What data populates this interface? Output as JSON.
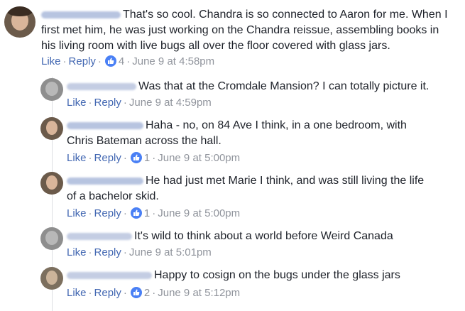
{
  "comments": [
    {
      "text": "That's so cool. Chandra is so connected to Aaron for me. When I first met him, he was just working on the Chandra reissue, assembling books in his living room with live bugs all over the floor covered with glass jars.",
      "like": "Like",
      "reply": "Reply",
      "reactions": "4",
      "time": "June 9 at 4:58pm"
    },
    {
      "text": "Was that at the Cromdale Mansion? I can totally picture it.",
      "like": "Like",
      "reply": "Reply",
      "reactions": "",
      "time": "June 9 at 4:59pm"
    },
    {
      "text": "Haha - no, on 84 Ave I think, in a one bedroom, with Chris Bateman across the hall.",
      "like": "Like",
      "reply": "Reply",
      "reactions": "1",
      "time": "June 9 at 5:00pm"
    },
    {
      "text": "He had just met Marie I think, and was still living the life of a bachelor skid.",
      "like": "Like",
      "reply": "Reply",
      "reactions": "1",
      "time": "June 9 at 5:00pm"
    },
    {
      "text": "It's wild to think about a world before Weird Canada",
      "like": "Like",
      "reply": "Reply",
      "reactions": "",
      "time": "June 9 at 5:01pm"
    },
    {
      "text": "Happy to cosign on the bugs under the glass jars",
      "like": "Like",
      "reply": "Reply",
      "reactions": "2",
      "time": "June 9 at 5:12pm"
    }
  ],
  "separator": "·",
  "colors": {
    "link": "#4267b2",
    "meta": "#90949c",
    "text": "#1d2129",
    "like_badge": "#4a80f5"
  },
  "icons": {
    "reaction": "thumbs-up-icon"
  }
}
